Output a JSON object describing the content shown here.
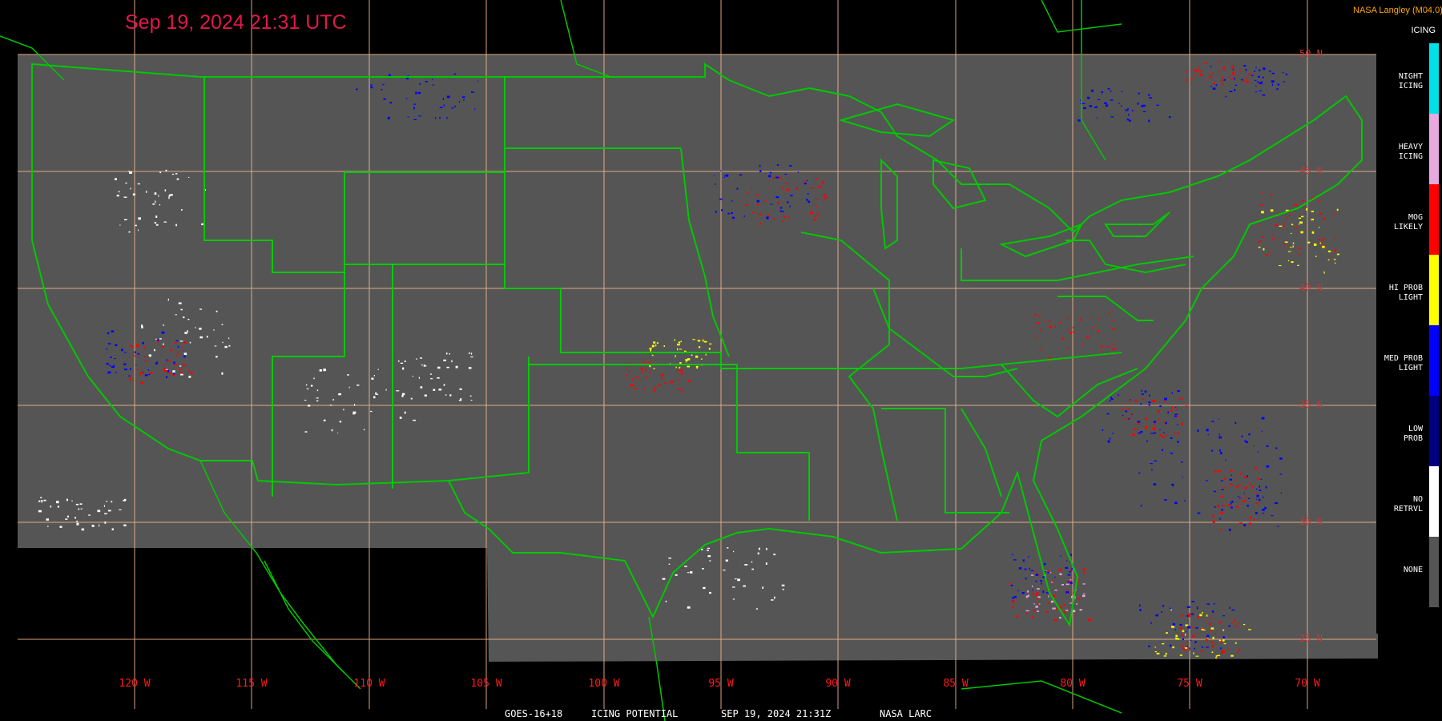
{
  "header": {
    "timestamp": "Sep 19, 2024 21:31 UTC",
    "credit": "NASA Langley (M04.0)"
  },
  "footer": {
    "satellite": "GOES-16+18",
    "product": "ICING POTENTIAL",
    "datetime": "SEP 19, 2024 21:31Z",
    "source": "NASA LARC"
  },
  "map": {
    "region": "Continental United States",
    "background_color": "#555555",
    "border_color": "#00c800",
    "grid_color": "#f0b48c",
    "longitude_labels": [
      "120 W",
      "115 W",
      "110 W",
      "105 W",
      "100 W",
      "95 W",
      "90 W",
      "85 W",
      "80 W",
      "75 W",
      "70 W"
    ],
    "latitude_labels": [
      "50 N",
      "45 N",
      "40 N",
      "35 N",
      "30 N",
      "25 N"
    ]
  },
  "legend": {
    "title": "ICING",
    "items": [
      {
        "label": "NIGHT\nICING",
        "color": "#00e0e8"
      },
      {
        "label": "HEAVY\nICING",
        "color": "#e8a8e0"
      },
      {
        "label": "MOG\nLIKELY",
        "color": "#ff0000"
      },
      {
        "label": "HI PROB\nLIGHT",
        "color": "#ffff00"
      },
      {
        "label": "MED PROB\nLIGHT",
        "color": "#0000ff"
      },
      {
        "label": "LOW\nPROB",
        "color": "#000080"
      },
      {
        "label": "NO\nRETRVL",
        "color": "#ffffff"
      },
      {
        "label": "NONE",
        "color": "#555555"
      }
    ]
  }
}
